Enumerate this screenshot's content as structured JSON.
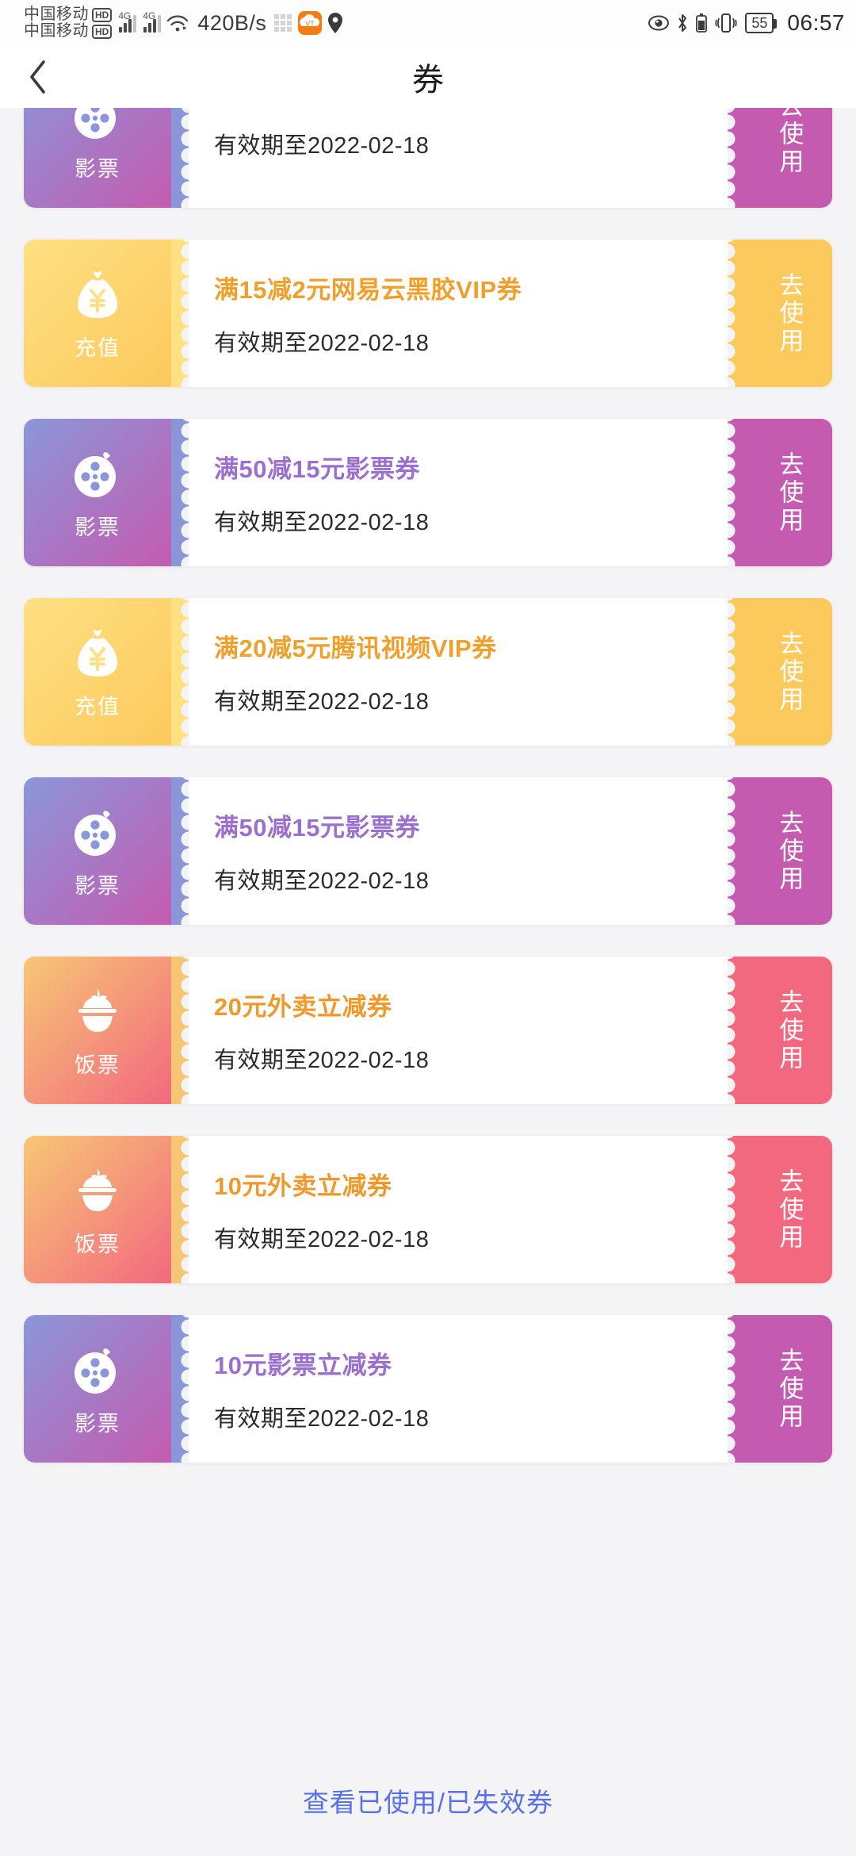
{
  "status_bar": {
    "carrier_line1": "中国移动",
    "carrier_line2": "中国移动",
    "hd_badge": "HD",
    "network_type_1": "4G",
    "network_type_2": "4G",
    "net_speed": "420B/s",
    "battery_percent": "55",
    "time": "06:57",
    "icons": [
      "grid-icon",
      "vt-app-icon",
      "location-pin-icon",
      "eye-icon",
      "bluetooth-icon",
      "battery-icon",
      "vibrate-icon"
    ],
    "vt_label": "VT"
  },
  "app_bar": {
    "back_label": "返回",
    "title": "券"
  },
  "footer": {
    "used_expired_link": "查看已使用/已失效券"
  },
  "colors": {
    "movie_start": "#8b96d9",
    "movie_end": "#c45bb0",
    "recharge_start": "#ffe083",
    "recharge_end": "#fcc95c",
    "food_start": "#f7c675",
    "food_end": "#f2697f",
    "movie_text": "#9b6fd0",
    "recharge_text": "#f0a02a",
    "food_text": "#f0992a",
    "link": "#5871e8",
    "page_bg": "#f4f4f6"
  },
  "labels": {
    "use_button": "去使用",
    "category_movie": "影票",
    "category_recharge": "充值",
    "category_food": "饭票"
  },
  "coupons": [
    {
      "category": "影票",
      "icon": "film-reel-icon",
      "title": "",
      "expiry": "有效期至2022-02-18",
      "action": "去使用",
      "theme": "movie",
      "partial_top": true
    },
    {
      "category": "充值",
      "icon": "money-bag-icon",
      "title": "满15减2元网易云黑胶VIP券",
      "expiry": "有效期至2022-02-18",
      "action": "去使用",
      "theme": "recharge"
    },
    {
      "category": "影票",
      "icon": "film-reel-icon",
      "title": "满50减15元影票券",
      "expiry": "有效期至2022-02-18",
      "action": "去使用",
      "theme": "movie"
    },
    {
      "category": "充值",
      "icon": "money-bag-icon",
      "title": "满20减5元腾讯视频VIP券",
      "expiry": "有效期至2022-02-18",
      "action": "去使用",
      "theme": "recharge"
    },
    {
      "category": "影票",
      "icon": "film-reel-icon",
      "title": "满50减15元影票券",
      "expiry": "有效期至2022-02-18",
      "action": "去使用",
      "theme": "movie"
    },
    {
      "category": "饭票",
      "icon": "rice-bowl-icon",
      "title": "20元外卖立减券",
      "expiry": "有效期至2022-02-18",
      "action": "去使用",
      "theme": "food"
    },
    {
      "category": "饭票",
      "icon": "rice-bowl-icon",
      "title": "10元外卖立减券",
      "expiry": "有效期至2022-02-18",
      "action": "去使用",
      "theme": "food"
    },
    {
      "category": "影票",
      "icon": "film-reel-icon",
      "title": "10元影票立减券",
      "expiry": "有效期至2022-02-18",
      "action": "去使用",
      "theme": "movie"
    }
  ]
}
